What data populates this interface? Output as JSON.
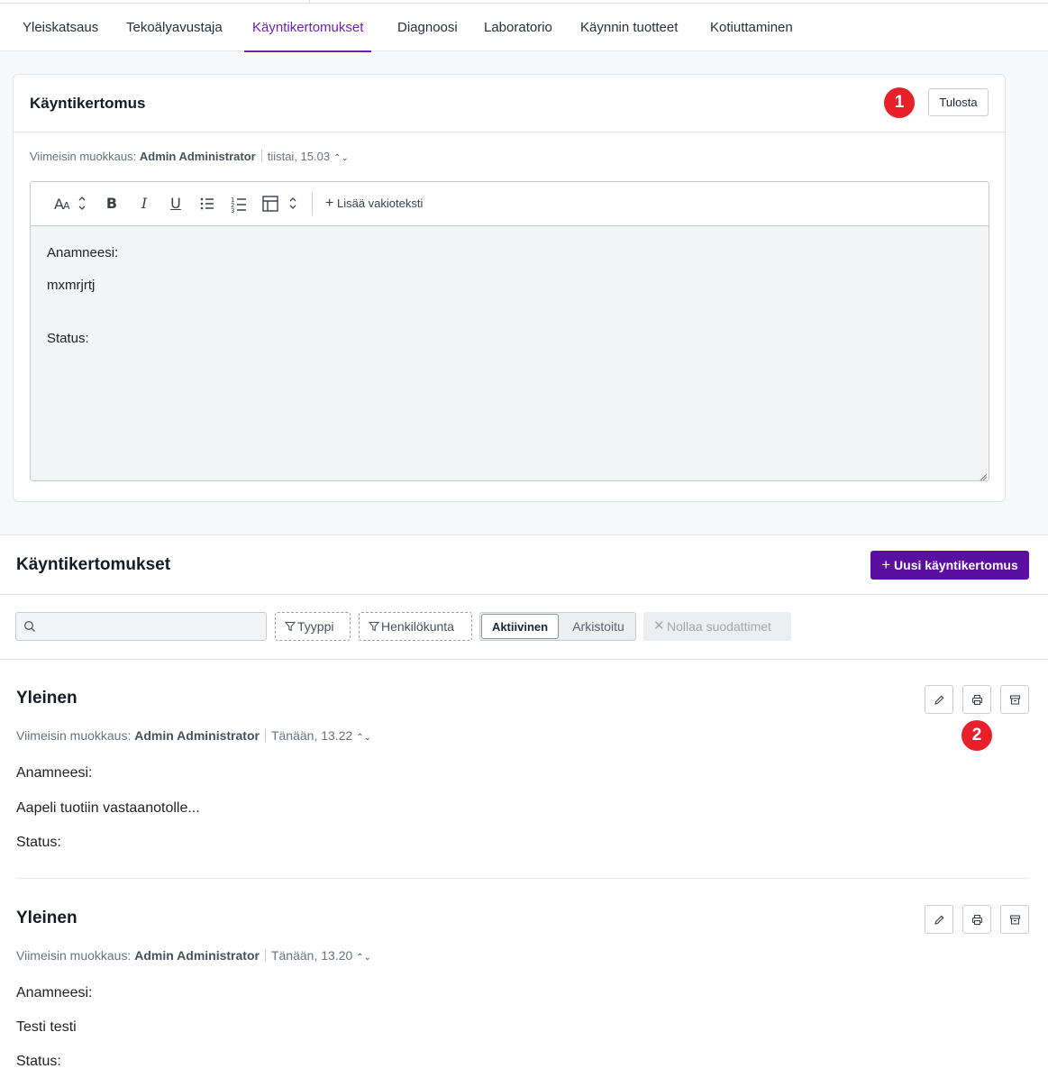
{
  "tabs": [
    {
      "label": "Yleiskatsaus"
    },
    {
      "label": "Tekoälyavustaja"
    },
    {
      "label": "Käyntikertomukset"
    },
    {
      "label": "Diagnoosi"
    },
    {
      "label": "Laboratorio"
    },
    {
      "label": "Käynnin tuotteet"
    },
    {
      "label": "Kotiuttaminen"
    }
  ],
  "active_tab": "Käyntikertomukset",
  "editor_card": {
    "title": "Käyntikertomus",
    "badge": "1",
    "print_label": "Tulosta",
    "meta_prefix": "Viimeisin muokkaus:",
    "meta_author": "Admin Administrator",
    "meta_time": "tiistai, 15.03",
    "toolbar": {
      "insert_label": "Lisää vakioteksti"
    },
    "content": [
      "Anamneesi:",
      "mxmrjrtj",
      "Status:"
    ]
  },
  "list": {
    "title": "Käyntikertomukset",
    "new_label": "Uusi käyntikertomus",
    "search": {
      "value": "",
      "placeholder": ""
    },
    "filters": {
      "type_label": "Tyyppi",
      "staff_label": "Henkilökunta",
      "active_label": "Aktiivinen",
      "archived_label": "Arkistoitu",
      "reset_label": "Nollaa suodattimet"
    },
    "badge": "2",
    "entries": [
      {
        "title": "Yleinen",
        "meta_prefix": "Viimeisin muokkaus:",
        "meta_author": "Admin Administrator",
        "meta_time": "Tänään, 13.22",
        "lines": [
          "Anamneesi:",
          "Aapeli tuotiin vastaanotolle...",
          "Status:"
        ]
      },
      {
        "title": "Yleinen",
        "meta_prefix": "Viimeisin muokkaus:",
        "meta_author": "Admin Administrator",
        "meta_time": "Tänään, 13.20",
        "lines": [
          "Anamneesi:",
          "Testi testi",
          "Status:"
        ]
      }
    ]
  },
  "colors": {
    "accent": "#6d22b0",
    "primary_button": "#5a0fa0",
    "badge": "#e8202b"
  }
}
